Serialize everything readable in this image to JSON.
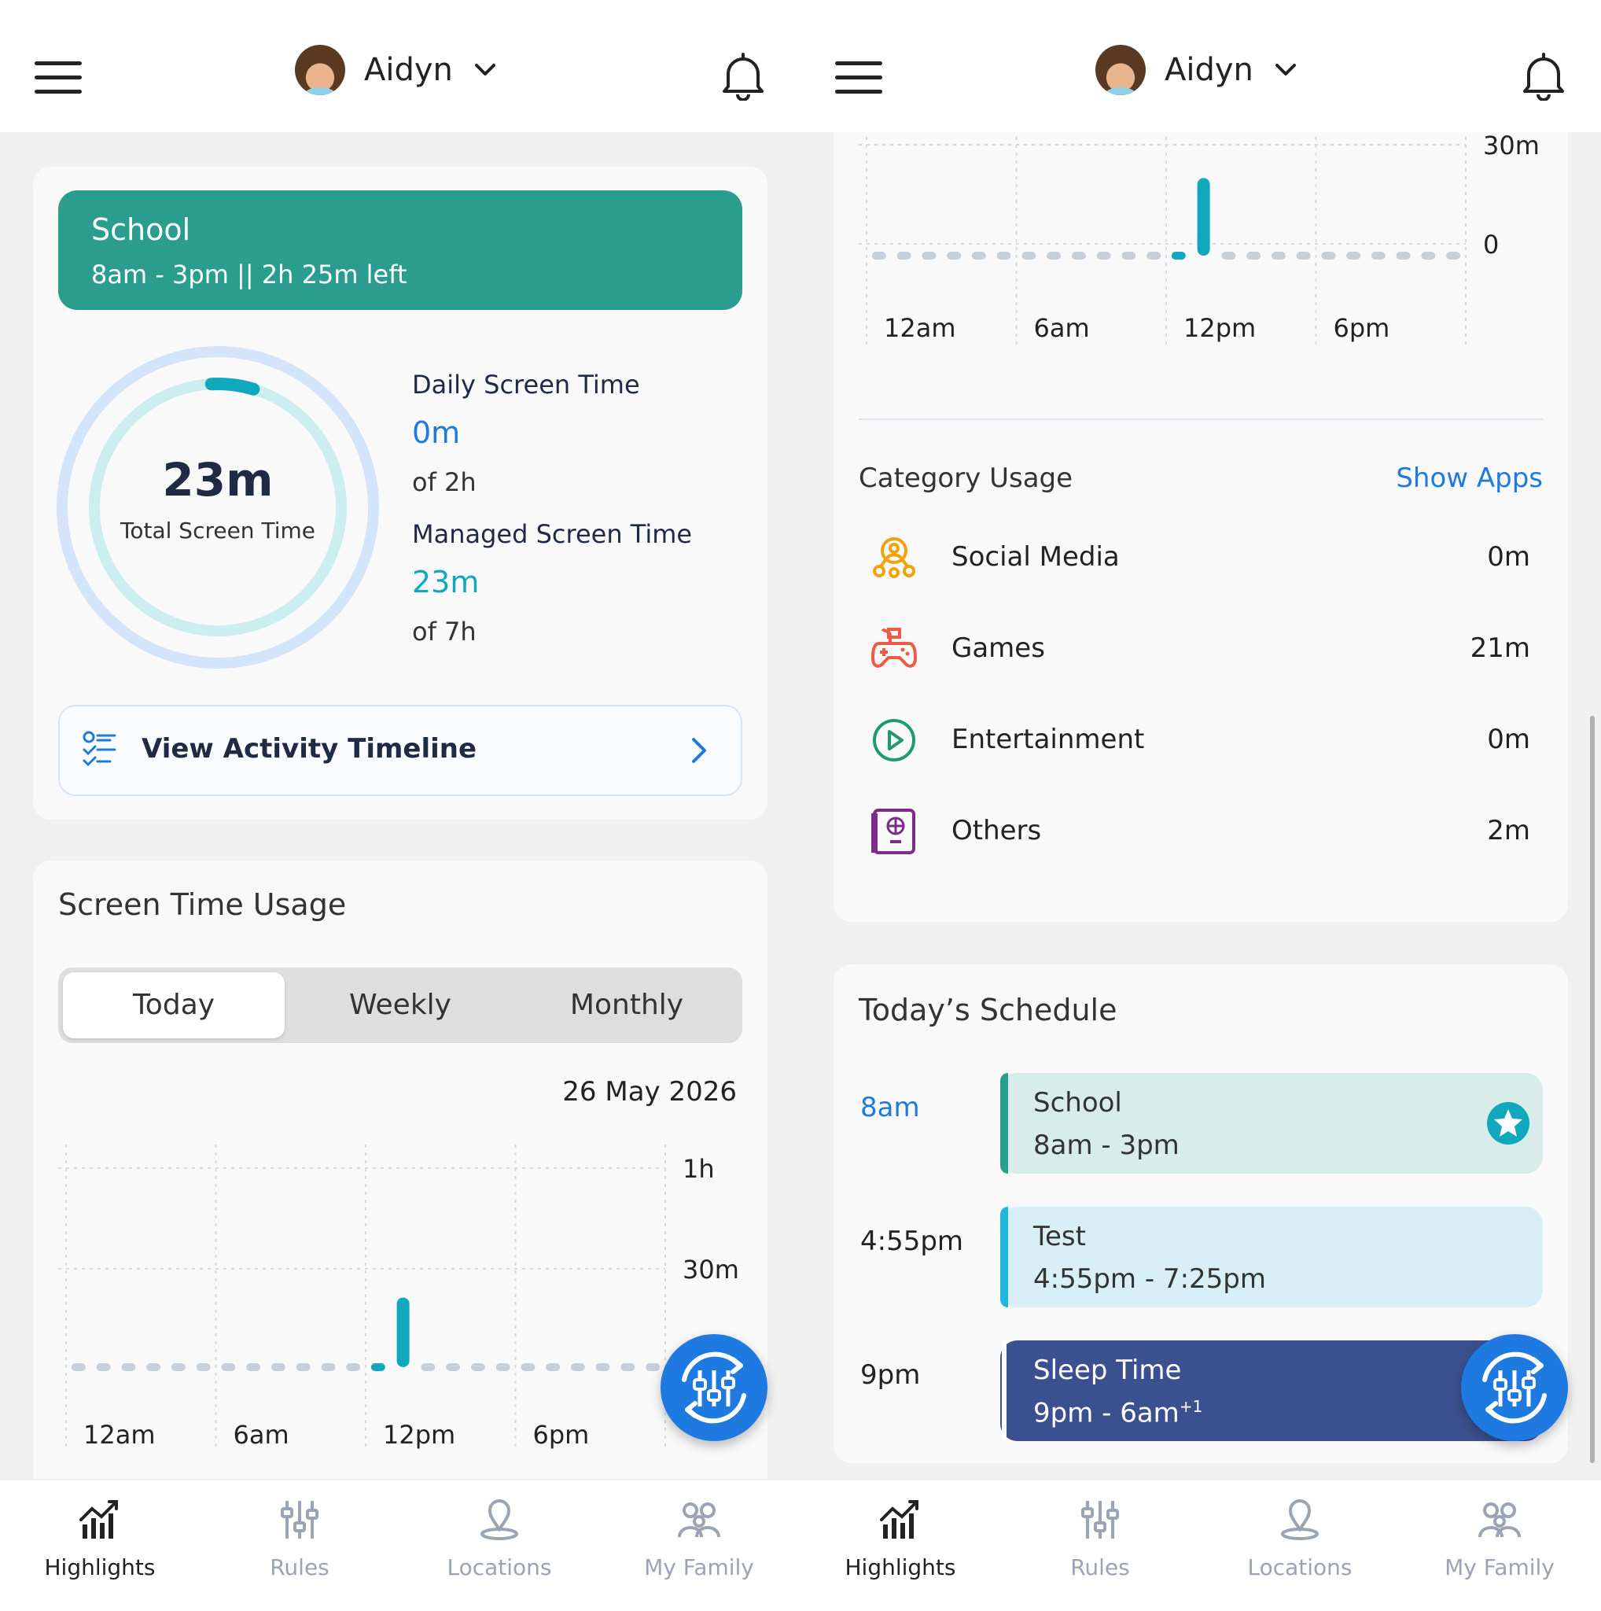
{
  "header": {
    "user_name": "Aidyn"
  },
  "left": {
    "status": {
      "title": "School",
      "subtitle": "8am - 3pm  ||  2h 25m left"
    },
    "ring": {
      "value": "23m",
      "label": "Total Screen Time",
      "progress_fraction": 0.055
    },
    "daily": {
      "label": "Daily Screen Time",
      "value": "0m",
      "of": "of 2h",
      "color": "#1e7ae0"
    },
    "managed": {
      "label": "Managed Screen Time",
      "value": "23m",
      "of": "of 7h",
      "color": "#11a7bd"
    },
    "view_button": "View Activity Timeline",
    "usage": {
      "title": "Screen Time Usage",
      "tabs": [
        "Today",
        "Weekly",
        "Monthly"
      ],
      "active_tab": "Today",
      "date": "26 May 2026"
    }
  },
  "chart_data": [
    {
      "type": "bar",
      "title": "Screen Time Usage",
      "x_ticks": [
        "12am",
        "6am",
        "12pm",
        "6pm"
      ],
      "y_ticks": [
        "1h",
        "30m"
      ],
      "ylim_minutes": [
        0,
        60
      ],
      "hourly_minutes": [
        0,
        0,
        0,
        0,
        0,
        0,
        0,
        0,
        0,
        0,
        0,
        0,
        0,
        21,
        0,
        0,
        0,
        0,
        0,
        0,
        0,
        0,
        0,
        0
      ],
      "grid": true,
      "bar_color": "#11a7bd"
    },
    {
      "type": "bar",
      "title": "",
      "x_ticks": [
        "12am",
        "6am",
        "12pm",
        "6pm"
      ],
      "y_ticks": [
        "30m",
        "0"
      ],
      "ylim_minutes": [
        0,
        30
      ],
      "hourly_minutes": [
        0,
        0,
        0,
        0,
        0,
        0,
        0,
        0,
        0,
        0,
        0,
        0,
        0,
        21,
        0,
        0,
        0,
        0,
        0,
        0,
        0,
        0,
        0,
        0
      ],
      "grid": true,
      "bar_color": "#11a7bd"
    }
  ],
  "right": {
    "category": {
      "title": "Category Usage",
      "show_apps": "Show Apps",
      "items": [
        {
          "name": "Social Media",
          "value": "0m",
          "icon": "social-media-icon",
          "color": "#f2a20c"
        },
        {
          "name": "Games",
          "value": "21m",
          "icon": "game-controller-icon",
          "color": "#ef5a44"
        },
        {
          "name": "Entertainment",
          "value": "0m",
          "icon": "play-icon",
          "color": "#1f9a6f"
        },
        {
          "name": "Others",
          "value": "2m",
          "icon": "passport-icon",
          "color": "#7b2d87"
        }
      ]
    },
    "schedule": {
      "title": "Today’s Schedule",
      "events": [
        {
          "time": "8am",
          "title": "School",
          "range": "8am - 3pm",
          "bg": "#d8ede9",
          "bar": "#2a9d8f",
          "time_color": "#1e7ae0"
        },
        {
          "time": "4:55pm",
          "title": "Test",
          "range": "4:55pm - 7:25pm",
          "bg": "#d9eff8",
          "bar": "#22b5e0",
          "time_color": "#222"
        },
        {
          "time": "9pm",
          "title": "Sleep Time",
          "range": "9pm - 6am",
          "range_sup": "+1",
          "bg": "#3b5090",
          "bar": "#ffffff",
          "time_color": "#222"
        }
      ]
    }
  },
  "nav": {
    "items": [
      {
        "label": "Highlights",
        "icon": "highlights-icon",
        "active": true
      },
      {
        "label": "Rules",
        "icon": "rules-icon",
        "active": false
      },
      {
        "label": "Locations",
        "icon": "location-pin-icon",
        "active": false
      },
      {
        "label": "My Family",
        "icon": "family-icon",
        "active": false
      }
    ]
  },
  "colors": {
    "accent_blue": "#1e7ae0",
    "teal": "#2a9d8f",
    "cyan": "#11a7bd",
    "navy": "#3b5090"
  }
}
